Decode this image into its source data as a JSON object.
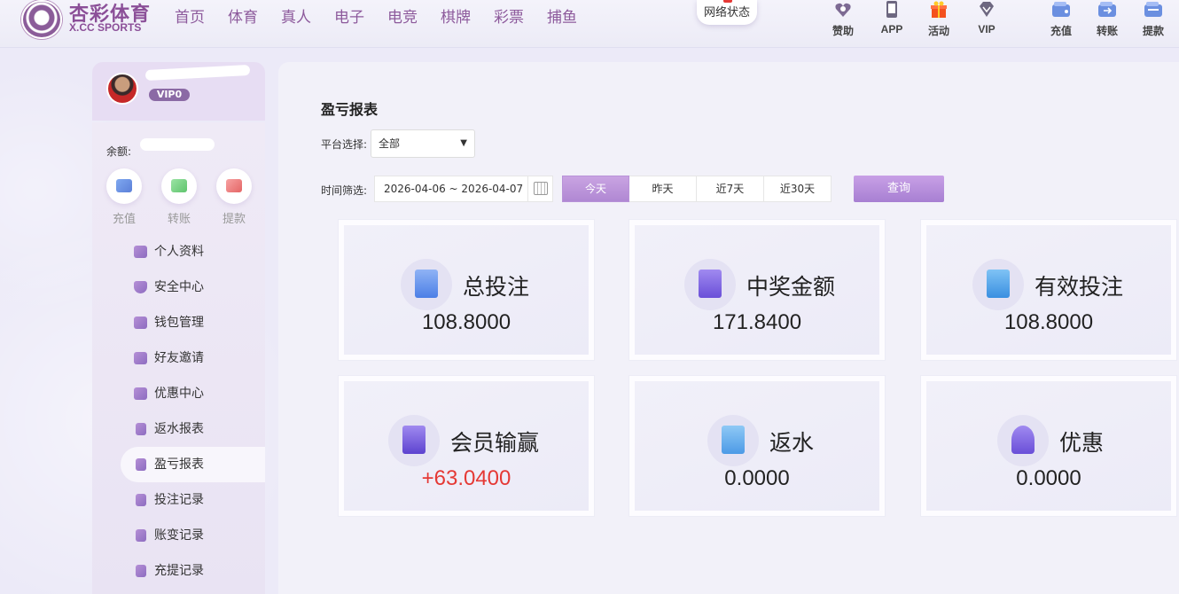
{
  "header": {
    "logo_cn": "杏彩体育",
    "logo_en": "X.CC SPORTS",
    "nav": [
      "首页",
      "体育",
      "真人",
      "电子",
      "电竞",
      "棋牌",
      "彩票",
      "捕鱼"
    ],
    "network_status": "网络状态",
    "quick_links": [
      {
        "label": "赞助",
        "icon": "sponsor-icon"
      },
      {
        "label": "APP",
        "icon": "phone-icon"
      },
      {
        "label": "活动",
        "icon": "gift-icon"
      },
      {
        "label": "VIP",
        "icon": "diamond-icon"
      },
      {
        "label": "充值",
        "icon": "deposit-wallet-icon"
      },
      {
        "label": "转账",
        "icon": "transfer-wallet-icon"
      },
      {
        "label": "提款",
        "icon": "withdraw-wallet-icon"
      }
    ]
  },
  "sidebar": {
    "vip_level": "VIP0",
    "balance_label": "余额:",
    "wallet_actions": [
      "充值",
      "转账",
      "提款"
    ],
    "menu": [
      "个人资料",
      "安全中心",
      "钱包管理",
      "好友邀请",
      "优惠中心",
      "返水报表",
      "盈亏报表",
      "投注记录",
      "账变记录",
      "充提记录"
    ],
    "active_menu": "盈亏报表"
  },
  "report": {
    "title": "盈亏报表",
    "platform_label": "平台选择:",
    "platform_value": "全部",
    "time_label": "时间筛选:",
    "date_range": "2026-04-06 ~ 2026-04-07",
    "range_tabs": [
      "今天",
      "昨天",
      "近7天",
      "近30天"
    ],
    "active_range": "今天",
    "query_label": "查询",
    "stats": [
      {
        "label": "总投注",
        "value": "108.8000"
      },
      {
        "label": "中奖金额",
        "value": "171.8400"
      },
      {
        "label": "有效投注",
        "value": "108.8000"
      },
      {
        "label": "会员输赢",
        "value": "+63.0400"
      },
      {
        "label": "返水",
        "value": "0.0000"
      },
      {
        "label": "优惠",
        "value": "0.0000"
      }
    ]
  },
  "colors": {
    "brand": "#8b4f98",
    "accent": "#b088d3",
    "positive_value": "#e53935"
  }
}
